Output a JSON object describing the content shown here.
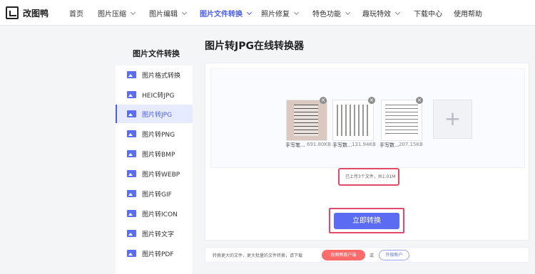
{
  "brand": {
    "name": "改图鸭"
  },
  "nav": [
    {
      "label": "首页",
      "has_dropdown": false,
      "active": false
    },
    {
      "label": "图片压缩",
      "has_dropdown": true,
      "active": false
    },
    {
      "label": "图片编辑",
      "has_dropdown": true,
      "active": false
    },
    {
      "label": "图片文件转换",
      "has_dropdown": true,
      "active": true
    },
    {
      "label": "照片修复",
      "has_dropdown": true,
      "active": false
    },
    {
      "label": "特色功能",
      "has_dropdown": true,
      "active": false
    },
    {
      "label": "趣玩特效",
      "has_dropdown": true,
      "active": false
    },
    {
      "label": "下载中心",
      "has_dropdown": false,
      "active": false
    },
    {
      "label": "使用帮助",
      "has_dropdown": false,
      "active": false
    }
  ],
  "page": {
    "title": "图片转JPG在线转换器"
  },
  "sidebar": {
    "title": "图片文件转换",
    "items": [
      {
        "label": "图片格式转换",
        "active": false
      },
      {
        "label": "HEIC转JPG",
        "active": false
      },
      {
        "label": "图片转JPG",
        "active": true
      },
      {
        "label": "图片转PNG",
        "active": false
      },
      {
        "label": "图片转BMP",
        "active": false
      },
      {
        "label": "图片转WEBP",
        "active": false
      },
      {
        "label": "图片转GIF",
        "active": false
      },
      {
        "label": "图片转ICON",
        "active": false
      },
      {
        "label": "图片转文字",
        "active": false
      },
      {
        "label": "图片转PDF",
        "active": false
      }
    ]
  },
  "files": [
    {
      "name": "手写笔...",
      "size": "691.80KB",
      "thumb": "photo"
    },
    {
      "name": "手写数...",
      "size": "131.94KB",
      "thumb": "grid"
    },
    {
      "name": "手写数...",
      "size": "207.15KB",
      "thumb": "text"
    }
  ],
  "upload": {
    "add_glyph": "+",
    "remove_glyph": "×",
    "status": "已上传3个文件，共1.01M"
  },
  "actions": {
    "convert_label": "立即转换"
  },
  "promo": {
    "text": "转换更大的文件、更大批量的文件转换，请下载",
    "client_label": "改图鸭客户端",
    "or": "或",
    "upgrade_label": "升级账户"
  },
  "colors": {
    "accent": "#5c6cf2",
    "nav_active": "#4a5df5",
    "highlight_box": "#e24a6b",
    "promo_button": "#ff6b6b"
  }
}
